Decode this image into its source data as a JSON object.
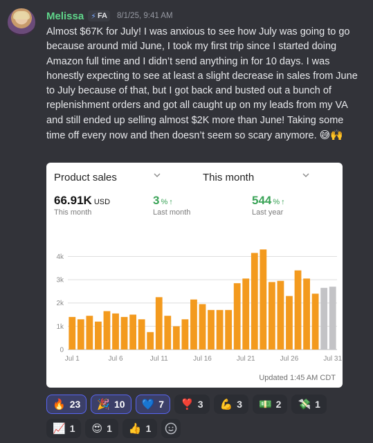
{
  "author": {
    "name": "Melissa",
    "tag_icon": "lightning-bolt-icon",
    "tag_text": "FA",
    "timestamp": "8/1/25, 9:41 AM"
  },
  "message": {
    "text": "Almost $67K for July! I was anxious to see how July was going to go because around mid June, I took my first trip since I started doing Amazon full time and I didn’t send anything in for 10 days. I was honestly expecting to see at least a slight decrease in sales from June to July because of that, but I got back and busted out a bunch of replenishment orders and got all caught up on my leads from my VA and still ended up selling almost $2K more than June! Taking some time off every now and then doesn’t seem so scary anymore. ",
    "emojis": "😅🙌"
  },
  "card": {
    "dropdown_metric": "Product sales",
    "dropdown_period": "This month",
    "total_value": "66.91K",
    "total_unit": "USD",
    "total_label": "This month",
    "vs_last_month_value": "3",
    "vs_last_month_unit": "%",
    "vs_last_month_label": "Last month",
    "vs_last_year_value": "544",
    "vs_last_year_unit": "%",
    "vs_last_year_label": "Last year",
    "updated": "Updated 1:45 AM CDT",
    "colors": {
      "bar": "#f39a1e",
      "bar_future": "#c3c3c6",
      "up_green": "#3aa357"
    }
  },
  "chart_data": {
    "type": "bar",
    "x": [
      1,
      2,
      3,
      4,
      5,
      6,
      7,
      8,
      9,
      10,
      11,
      12,
      13,
      14,
      15,
      16,
      17,
      18,
      19,
      20,
      21,
      22,
      23,
      24,
      25,
      26,
      27,
      28,
      29,
      30,
      31
    ],
    "values": [
      1400,
      1300,
      1450,
      1200,
      1650,
      1550,
      1400,
      1500,
      1300,
      750,
      2250,
      1450,
      1000,
      1300,
      2150,
      1950,
      1700,
      1700,
      1700,
      2850,
      3050,
      4150,
      4300,
      2900,
      2950,
      2300,
      3400,
      3050,
      2400,
      2650,
      2700
    ],
    "status": [
      "actual",
      "actual",
      "actual",
      "actual",
      "actual",
      "actual",
      "actual",
      "actual",
      "actual",
      "actual",
      "actual",
      "actual",
      "actual",
      "actual",
      "actual",
      "actual",
      "actual",
      "actual",
      "actual",
      "actual",
      "actual",
      "actual",
      "actual",
      "actual",
      "actual",
      "actual",
      "actual",
      "actual",
      "actual",
      "pending",
      "pending"
    ],
    "xticks": [
      {
        "day": 1,
        "label": "Jul 1"
      },
      {
        "day": 6,
        "label": "Jul 6"
      },
      {
        "day": 11,
        "label": "Jul 11"
      },
      {
        "day": 16,
        "label": "Jul 16"
      },
      {
        "day": 21,
        "label": "Jul 21"
      },
      {
        "day": 26,
        "label": "Jul 26"
      },
      {
        "day": 31,
        "label": "Jul 31"
      }
    ],
    "yticks": [
      {
        "value": 0,
        "label": "0"
      },
      {
        "value": 1000,
        "label": "1k"
      },
      {
        "value": 2000,
        "label": "2k"
      },
      {
        "value": 3000,
        "label": "3k"
      },
      {
        "value": 4000,
        "label": "4k"
      }
    ],
    "ylim": [
      0,
      4400
    ],
    "grid": true
  },
  "reactions": [
    [
      {
        "icon": "fire-icon",
        "emoji": "🔥",
        "count": "23",
        "active": true
      },
      {
        "icon": "party-popper-icon",
        "emoji": "🎉",
        "count": "10",
        "active": true
      },
      {
        "icon": "blue-heart-icon",
        "emoji": "💙",
        "count": "7",
        "active": true
      },
      {
        "icon": "heart-exclamation-icon",
        "emoji": "❣️",
        "count": "3",
        "active": false
      },
      {
        "icon": "flexed-biceps-icon",
        "emoji": "💪",
        "count": "3",
        "active": false
      },
      {
        "icon": "dollar-banknote-icon",
        "emoji": "💵",
        "count": "2",
        "active": false
      },
      {
        "icon": "money-with-wings-icon",
        "emoji": "💸",
        "count": "1",
        "active": false
      }
    ],
    [
      {
        "icon": "chart-increasing-icon",
        "emoji": "📈",
        "count": "1",
        "active": false
      },
      {
        "icon": "heart-eyes-icon",
        "emoji": "😍",
        "count": "1",
        "active": false
      },
      {
        "icon": "thumbs-up-icon",
        "emoji": "👍",
        "count": "1",
        "active": false
      }
    ]
  ]
}
